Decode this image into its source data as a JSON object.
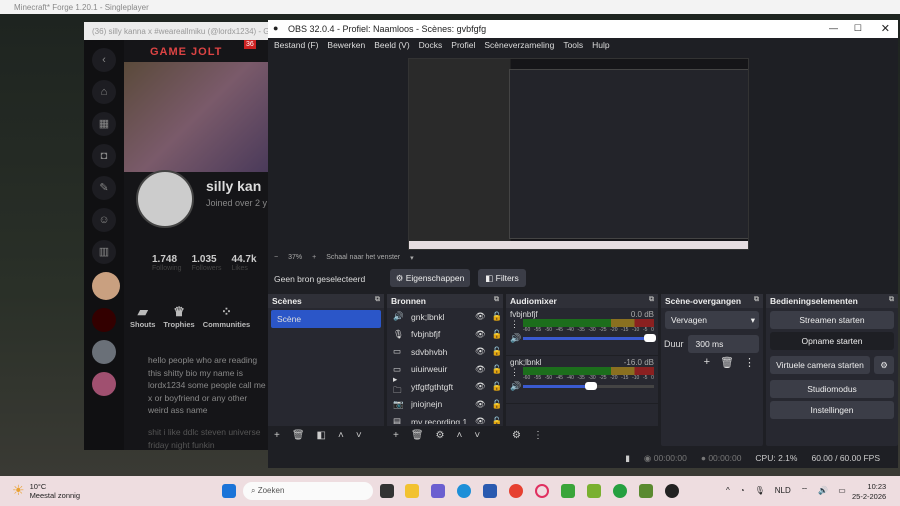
{
  "minecraft": {
    "title": "Minecraft* Forge 1.20.1 - Singleplayer"
  },
  "browser": {
    "tab_title": "(36) silly kanna x #weareallmiku (@lordx1234) - Game Jolt",
    "logo": "GAME JOLT",
    "badge": "36",
    "profile": {
      "name": "silly kan",
      "joined": "Joined over 2 y",
      "stats": [
        {
          "value": "1.748",
          "label": "Following"
        },
        {
          "value": "1.035",
          "label": "Followers"
        },
        {
          "value": "44.7k",
          "label": "Likes"
        }
      ],
      "tabs": [
        "Shouts",
        "Trophies",
        "Communities"
      ],
      "bio1": "hello people who are reading this shitty bio my name is lordx1234 some people call me x or boyfriend or any other weird ass name",
      "bio2": "shit i like ddlc steven universe friday night funkin"
    }
  },
  "obs": {
    "title": "OBS 32.0.4 - Profiel: Naamloos - Scènes: gvbfgfg",
    "menu": [
      "Bestand (F)",
      "Bewerken",
      "Beeld (V)",
      "Docks",
      "Profiel",
      "Scèneverzameling",
      "Tools",
      "Hulp"
    ],
    "zoom": {
      "minus": "−",
      "value": "37%",
      "plus": "+",
      "mode": "Schaal naar het venster"
    },
    "source_bar": {
      "status": "Geen bron geselecteerd",
      "properties": "Eigenschappen",
      "filters": "Filters"
    },
    "scenes": {
      "title": "Scènes",
      "items": [
        "Scène"
      ]
    },
    "sources": {
      "title": "Bronnen",
      "items": [
        {
          "icon": "speaker-icon",
          "name": "gnk;lbnkl"
        },
        {
          "icon": "microphone-icon",
          "name": "fvbjnbfjf"
        },
        {
          "icon": "monitor-icon",
          "name": "sdvbhvbh"
        },
        {
          "icon": "monitor-icon",
          "name": "uiuirweuir"
        },
        {
          "icon": "folder-icon",
          "name": "ytfgtfgthtgft"
        },
        {
          "icon": "camera-icon",
          "name": "jniojnejn"
        },
        {
          "icon": "window-icon",
          "name": "my recording 1"
        }
      ]
    },
    "audiomixer": {
      "title": "Audiomixer",
      "scale": [
        "-60",
        "-55",
        "-50",
        "-45",
        "-40",
        "-35",
        "-30",
        "-25",
        "-20",
        "-15",
        "-10",
        "-5",
        "0"
      ],
      "channels": [
        {
          "name": "fvbjnbfjf",
          "db": "0.0 dB",
          "volume": 1.0
        },
        {
          "name": "gnk;lbnkl",
          "db": "-16.0 dB",
          "volume": 0.55
        }
      ]
    },
    "transitions": {
      "title": "Scène-overgangen",
      "type": "Vervagen",
      "duration_label": "Duur",
      "duration": "300 ms"
    },
    "controls": {
      "title": "Bedieningselementen",
      "buttons": [
        "Streamen starten",
        "Opname starten",
        "Virtuele camera starten",
        "Studiomodus",
        "Instellingen"
      ]
    },
    "status": {
      "stream_time": "00:00:00",
      "rec_time": "00:00:00",
      "cpu": "CPU: 2.1%",
      "fps": "60.00 / 60.00 FPS"
    }
  },
  "taskbar": {
    "weather_temp": "10°C",
    "weather_desc": "Meestal zonnig",
    "search": "Zoeken",
    "lang": "NLD",
    "time": "10:23",
    "date": "25-2-2026"
  }
}
